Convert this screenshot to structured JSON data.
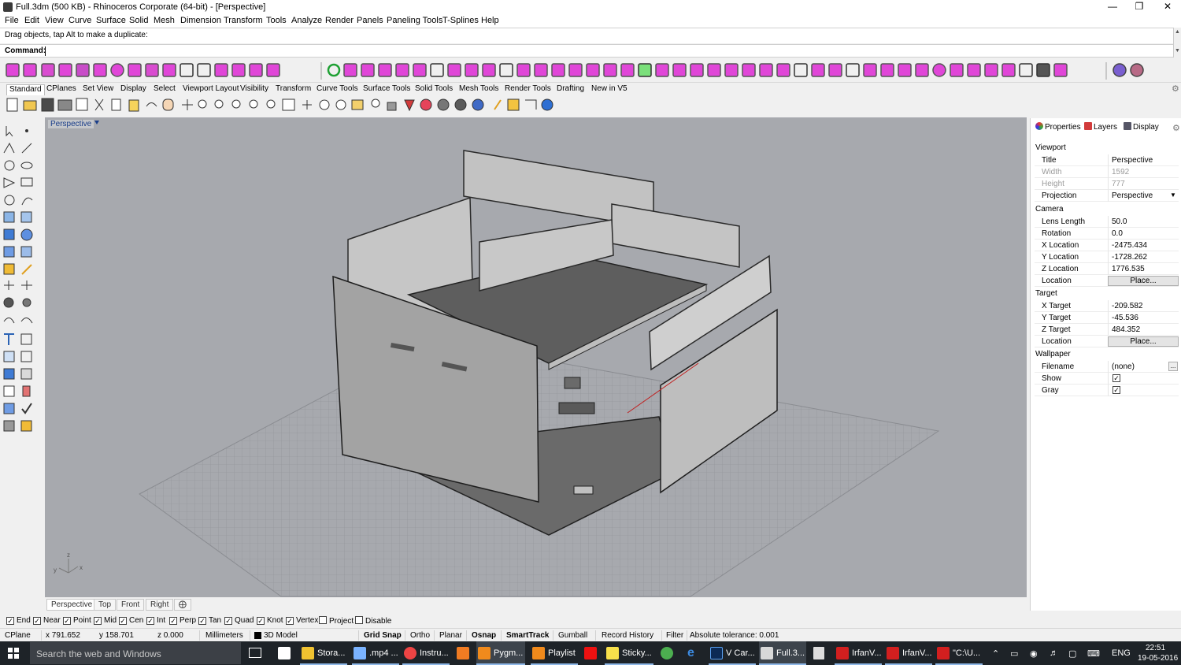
{
  "window": {
    "title": "Full.3dm (500 KB) - Rhinoceros Corporate (64-bit) - [Perspective]"
  },
  "menu": [
    "File",
    "Edit",
    "View",
    "Curve",
    "Surface",
    "Solid",
    "Mesh",
    "Dimension",
    "Transform",
    "Tools",
    "Analyze",
    "Render",
    "Panels",
    "Paneling Tools",
    "T-Splines",
    "Help"
  ],
  "command": {
    "history": "Drag objects, tap Alt to make a duplicate:",
    "label": "Command:"
  },
  "toolbar_tabs": [
    "Standard",
    "CPlanes",
    "Set View",
    "Display",
    "Select",
    "Viewport Layout",
    "Visibility",
    "Transform",
    "Curve Tools",
    "Surface Tools",
    "Solid Tools",
    "Mesh Tools",
    "Render Tools",
    "Drafting",
    "New in V5"
  ],
  "viewport": {
    "title": "Perspective",
    "axis_z": "z",
    "axis_y": "y",
    "axis_x": "x"
  },
  "viewport_tabs": [
    "Perspective",
    "Top",
    "Front",
    "Right"
  ],
  "panel": {
    "tabs": [
      "Properties",
      "Layers",
      "Display"
    ],
    "sections": {
      "viewport": "Viewport",
      "camera": "Camera",
      "target": "Target",
      "wallpaper": "Wallpaper"
    },
    "title_label": "Title",
    "title_value": "Perspective",
    "width_label": "Width",
    "width_value": "1592",
    "height_label": "Height",
    "height_value": "777",
    "projection_label": "Projection",
    "projection_value": "Perspective",
    "lens_label": "Lens Length",
    "lens_value": "50.0",
    "rotation_label": "Rotation",
    "rotation_value": "0.0",
    "xloc_label": "X Location",
    "xloc_value": "-2475.434",
    "yloc_label": "Y Location",
    "yloc_value": "-1728.262",
    "zloc_label": "Z Location",
    "zloc_value": "1776.535",
    "location_label": "Location",
    "place_button": "Place...",
    "xtgt_label": "X Target",
    "xtgt_value": "-209.582",
    "ytgt_label": "Y Target",
    "ytgt_value": "-45.536",
    "ztgt_label": "Z Target",
    "ztgt_value": "484.352",
    "filename_label": "Filename",
    "filename_value": "(none)",
    "browse": "...",
    "show_label": "Show",
    "gray_label": "Gray"
  },
  "osnap": [
    {
      "label": "End",
      "checked": true
    },
    {
      "label": "Near",
      "checked": true
    },
    {
      "label": "Point",
      "checked": true
    },
    {
      "label": "Mid",
      "checked": true
    },
    {
      "label": "Cen",
      "checked": true
    },
    {
      "label": "Int",
      "checked": true
    },
    {
      "label": "Perp",
      "checked": true
    },
    {
      "label": "Tan",
      "checked": true
    },
    {
      "label": "Quad",
      "checked": true
    },
    {
      "label": "Knot",
      "checked": true
    },
    {
      "label": "Vertex",
      "checked": true
    },
    {
      "label": "Project",
      "checked": false
    },
    {
      "label": "Disable",
      "checked": false
    }
  ],
  "status": {
    "cplane": "CPlane",
    "x": "x 791.652",
    "y": "y 158.701",
    "z": "z 0.000",
    "units": "Millimeters",
    "layer": "3D Model",
    "grid_snap": "Grid Snap",
    "ortho": "Ortho",
    "planar": "Planar",
    "osnap": "Osnap",
    "smarttrack": "SmartTrack",
    "gumball": "Gumball",
    "record_history": "Record History",
    "filter": "Filter",
    "tolerance": "Absolute tolerance: 0.001"
  },
  "taskbar": {
    "search": "Search the web and Windows",
    "apps": [
      "Stora...",
      ".mp4 ...",
      "Instru...",
      "Pygm...",
      "Playlist",
      "Sticky...",
      "V Car...",
      "Full.3...",
      "IrfanV...",
      "IrfanV...",
      "\"C:\\U..."
    ],
    "lang": "ENG",
    "time": "22:51",
    "date": "19-05-2016"
  },
  "colors": {
    "viewport_bg": "#a7a9ae",
    "panel_accent": "#1a3e8a",
    "taskbar": "#1e2328"
  }
}
